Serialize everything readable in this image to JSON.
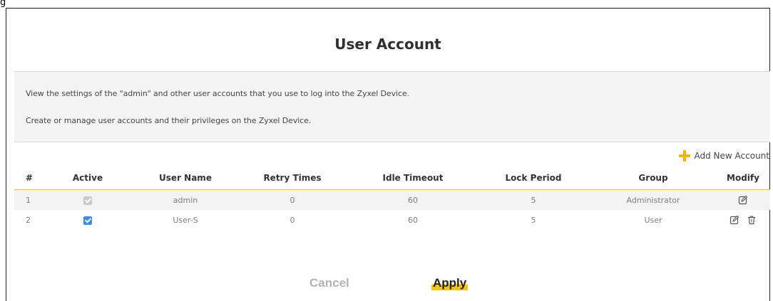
{
  "figure_tag": "g",
  "page": {
    "title": "User Account",
    "description_lines": [
      "View the settings of the \"admin\" and other user accounts that you use to log into the Zyxel Device.",
      "Create or manage user accounts and their privileges on the Zyxel Device."
    ]
  },
  "actions": {
    "add_new_account_label": "Add New Account",
    "add_icon": "plus-icon",
    "cancel_label": "Cancel",
    "apply_label": "Apply"
  },
  "table": {
    "columns": [
      "#",
      "Active",
      "User Name",
      "Retry Times",
      "Idle Timeout",
      "Lock Period",
      "Group",
      "Modify"
    ],
    "rows": [
      {
        "num": "1",
        "active": true,
        "active_editable": false,
        "user_name": "admin",
        "retry_times": "0",
        "idle_timeout": "60",
        "lock_period": "5",
        "group": "Administrator",
        "modify_icons": [
          "edit-icon"
        ]
      },
      {
        "num": "2",
        "active": true,
        "active_editable": true,
        "user_name": "User-S",
        "retry_times": "0",
        "idle_timeout": "60",
        "lock_period": "5",
        "group": "User",
        "modify_icons": [
          "edit-icon",
          "delete-icon"
        ]
      }
    ]
  },
  "colors": {
    "accent": "#f5b400",
    "apply_highlight": "#ffc400",
    "checkbox_active": "#3a8ee6",
    "checkbox_disabled": "#c9c9c9",
    "header_divider": "#f2c22b"
  }
}
